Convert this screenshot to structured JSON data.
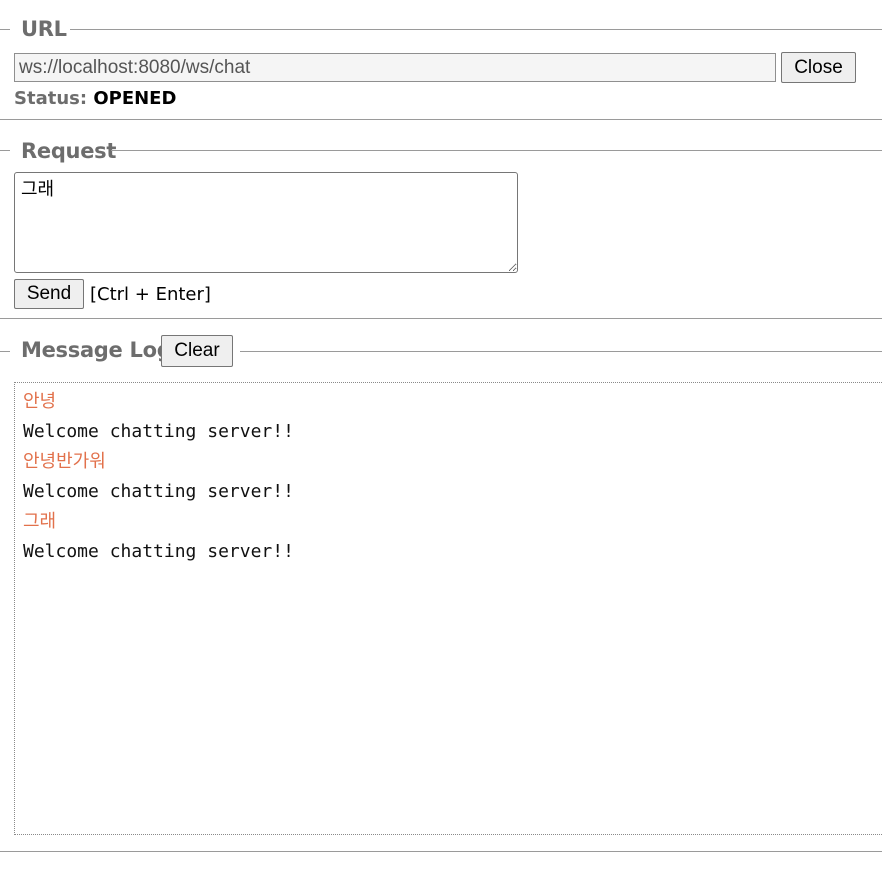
{
  "url_section": {
    "legend": "URL",
    "url_value": "ws://localhost:8080/ws/chat",
    "close_label": "Close",
    "status_label": "Status:",
    "status_value": "OPENED"
  },
  "request_section": {
    "legend": "Request",
    "text_value": "그래",
    "send_label": "Send",
    "shortcut_hint": "[Ctrl + Enter]"
  },
  "log_section": {
    "legend": "Message Log",
    "clear_label": "Clear",
    "messages": [
      {
        "kind": "sent",
        "text": "안녕"
      },
      {
        "kind": "received",
        "text": "Welcome chatting server!!"
      },
      {
        "kind": "sent",
        "text": "안녕반가워"
      },
      {
        "kind": "received",
        "text": "Welcome chatting server!!"
      },
      {
        "kind": "sent",
        "text": "그래"
      },
      {
        "kind": "received",
        "text": "Welcome chatting server!!"
      }
    ]
  },
  "colors": {
    "sent_message": "#e2714b",
    "received_message": "#111111",
    "legend_text": "#6d6d6d"
  }
}
